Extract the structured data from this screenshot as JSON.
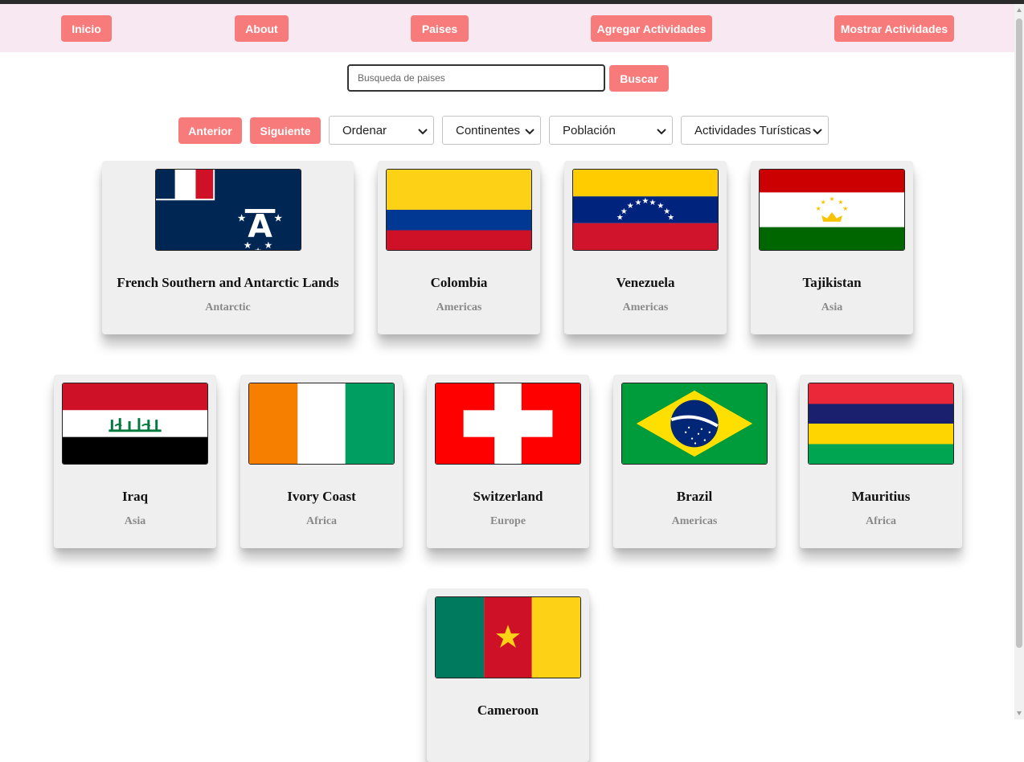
{
  "nav": {
    "inicio": "Inicio",
    "about": "About",
    "paises": "Paises",
    "agregar": "Agregar Actividades",
    "mostrar": "Mostrar Actividades"
  },
  "search": {
    "placeholder": "Busqueda de paises",
    "value": "",
    "button": "Buscar"
  },
  "controls": {
    "anterior": "Anterior",
    "siguiente": "Siguiente",
    "ordenar": "Ordenar",
    "continentes": "Continentes",
    "poblacion": "Población",
    "actividades": "Actividades Turísticas"
  },
  "countries": [
    {
      "name": "French Southern and Antarctic Lands",
      "continent": "Antarctic",
      "flag": "flag-tf-icon"
    },
    {
      "name": "Colombia",
      "continent": "Americas",
      "flag": "flag-co-icon"
    },
    {
      "name": "Venezuela",
      "continent": "Americas",
      "flag": "flag-ve-icon"
    },
    {
      "name": "Tajikistan",
      "continent": "Asia",
      "flag": "flag-tj-icon"
    },
    {
      "name": "Iraq",
      "continent": "Asia",
      "flag": "flag-iq-icon"
    },
    {
      "name": "Ivory Coast",
      "continent": "Africa",
      "flag": "flag-ci-icon"
    },
    {
      "name": "Switzerland",
      "continent": "Europe",
      "flag": "flag-ch-icon"
    },
    {
      "name": "Brazil",
      "continent": "Americas",
      "flag": "flag-br-icon"
    },
    {
      "name": "Mauritius",
      "continent": "Africa",
      "flag": "flag-mu-icon"
    },
    {
      "name": "Cameroon",
      "continent": "",
      "flag": "flag-cm-icon"
    }
  ],
  "colors": {
    "accent": "#f87b7c",
    "navbar_bg": "#f8e8f2",
    "card_bg": "#efefef"
  }
}
